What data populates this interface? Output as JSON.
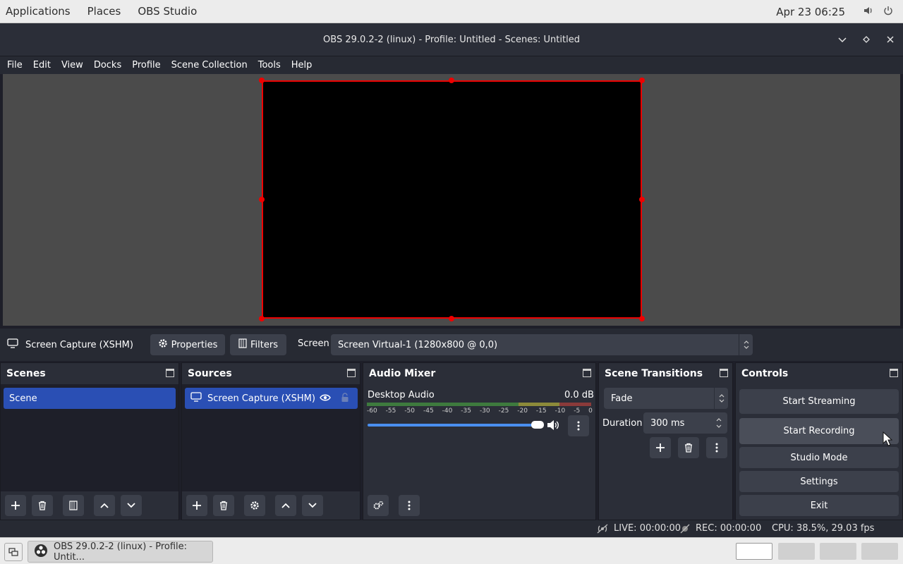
{
  "topbar": {
    "applications": "Applications",
    "places": "Places",
    "app_name": "OBS Studio",
    "clock": "Apr 23  06:25"
  },
  "window": {
    "title": "OBS 29.0.2-2 (linux) - Profile: Untitled - Scenes: Untitled"
  },
  "menubar": {
    "items": [
      "File",
      "Edit",
      "View",
      "Docks",
      "Profile",
      "Scene Collection",
      "Tools",
      "Help"
    ]
  },
  "source_toolbar": {
    "current_source": "Screen Capture (XSHM)",
    "properties": "Properties",
    "filters": "Filters",
    "screen_label": "Screen",
    "screen_value": "Screen Virtual-1 (1280x800 @ 0,0)"
  },
  "scenes": {
    "title": "Scenes",
    "items": [
      "Scene"
    ]
  },
  "sources": {
    "title": "Sources",
    "items": [
      "Screen Capture (XSHM)"
    ]
  },
  "mixer": {
    "title": "Audio Mixer",
    "channel": "Desktop Audio",
    "level": "0.0 dB",
    "ticks": [
      "-60",
      "-55",
      "-50",
      "-45",
      "-40",
      "-35",
      "-30",
      "-25",
      "-20",
      "-15",
      "-10",
      "-5",
      "0"
    ]
  },
  "transitions": {
    "title": "Scene Transitions",
    "selected": "Fade",
    "duration_label": "Duration",
    "duration_value": "300 ms"
  },
  "controls": {
    "title": "Controls",
    "start_streaming": "Start Streaming",
    "start_recording": "Start Recording",
    "studio_mode": "Studio Mode",
    "settings": "Settings",
    "exit": "Exit"
  },
  "status": {
    "live": "LIVE: 00:00:00",
    "rec": "REC: 00:00:00",
    "cpu": "CPU: 38.5%, 29.03 fps"
  },
  "taskbar": {
    "task_label": "OBS 29.0.2-2 (linux) - Profile: Untit..."
  },
  "colors": {
    "selection": "#2a4fb4",
    "dock_bg": "#2b2e38",
    "list_bg": "#1e1f29",
    "button": "#3c404b",
    "preview_border": "#ee0000"
  }
}
